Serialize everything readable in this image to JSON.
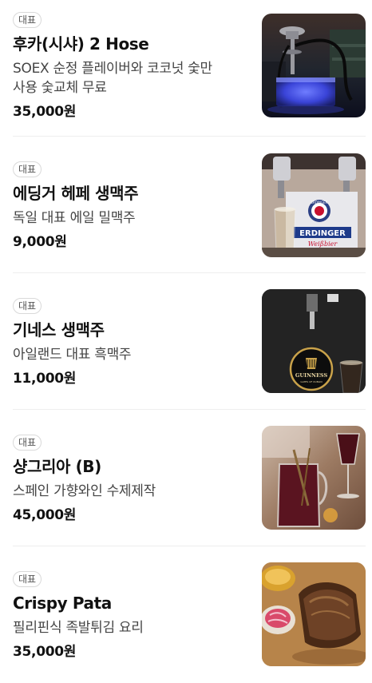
{
  "menu": {
    "items": [
      {
        "badge": "대표",
        "name": "후카(시샤) 2 Hose",
        "desc_line1": "SOEX 순정 플레이버와 코코넛 숯만",
        "desc_line2": "사용 숯교체 무료",
        "price": "35,000원"
      },
      {
        "badge": "대표",
        "name": "에딩거 헤페 생맥주",
        "desc_line1": "독일 대표 에일 밀맥주",
        "price": "9,000원",
        "image_text_brand": "ERDINGER",
        "image_text_script": "Weißbier",
        "image_text_round": "ERDINGER"
      },
      {
        "badge": "대표",
        "name": "기네스 생맥주",
        "desc_line1": "아일랜드 대표 흑맥주",
        "price": "11,000원",
        "image_text_brand": "GUINNESS",
        "image_text_sub": "GATES OF DUBLIN"
      },
      {
        "badge": "대표",
        "name": "샹그리아 (B)",
        "desc_line1": "스페인 가향와인 수제제작",
        "price": "45,000원"
      },
      {
        "badge": "대표",
        "name": "Crispy Pata",
        "desc_line1": "필리핀식 족발튀김 요리",
        "price": "35,000원"
      }
    ]
  }
}
